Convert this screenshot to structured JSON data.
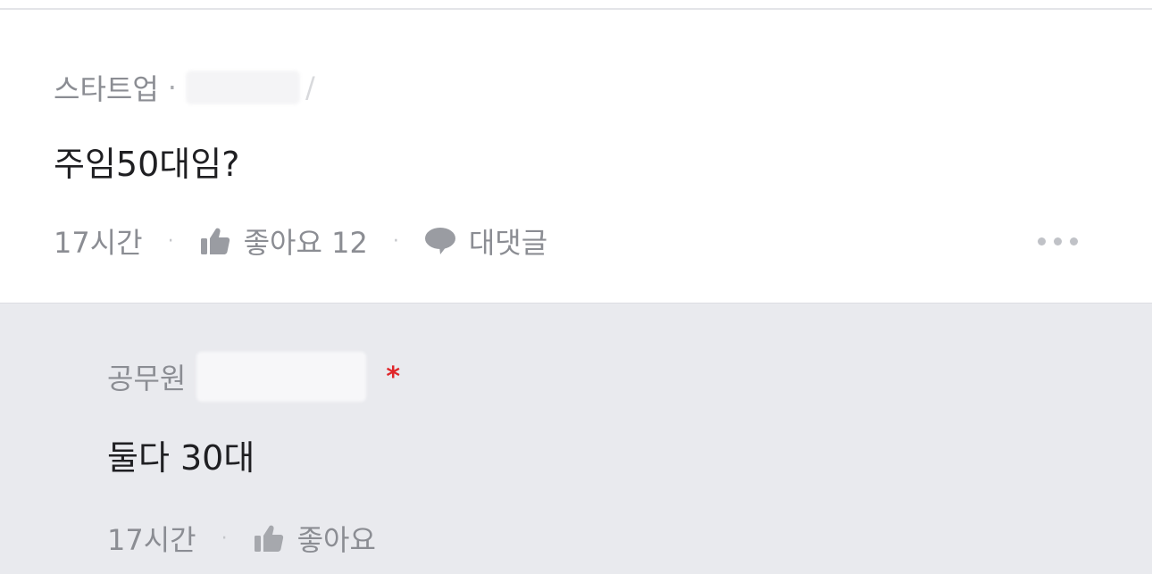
{
  "comment": {
    "category": "스타트업",
    "separator": "·",
    "company_slash": "/",
    "text": "주임50대임?",
    "time": "17시간",
    "like_label": "좋아요 12",
    "reply_label": "대댓글",
    "more_icon": "more-dots-icon"
  },
  "reply": {
    "category": "공무원",
    "badge": "*",
    "text": "둘다 30대",
    "time": "17시간",
    "like_label": "좋아요"
  },
  "colors": {
    "reply_background": "#e9eaee",
    "badge": "#e0262a",
    "meta_text": "#8b8d93"
  }
}
